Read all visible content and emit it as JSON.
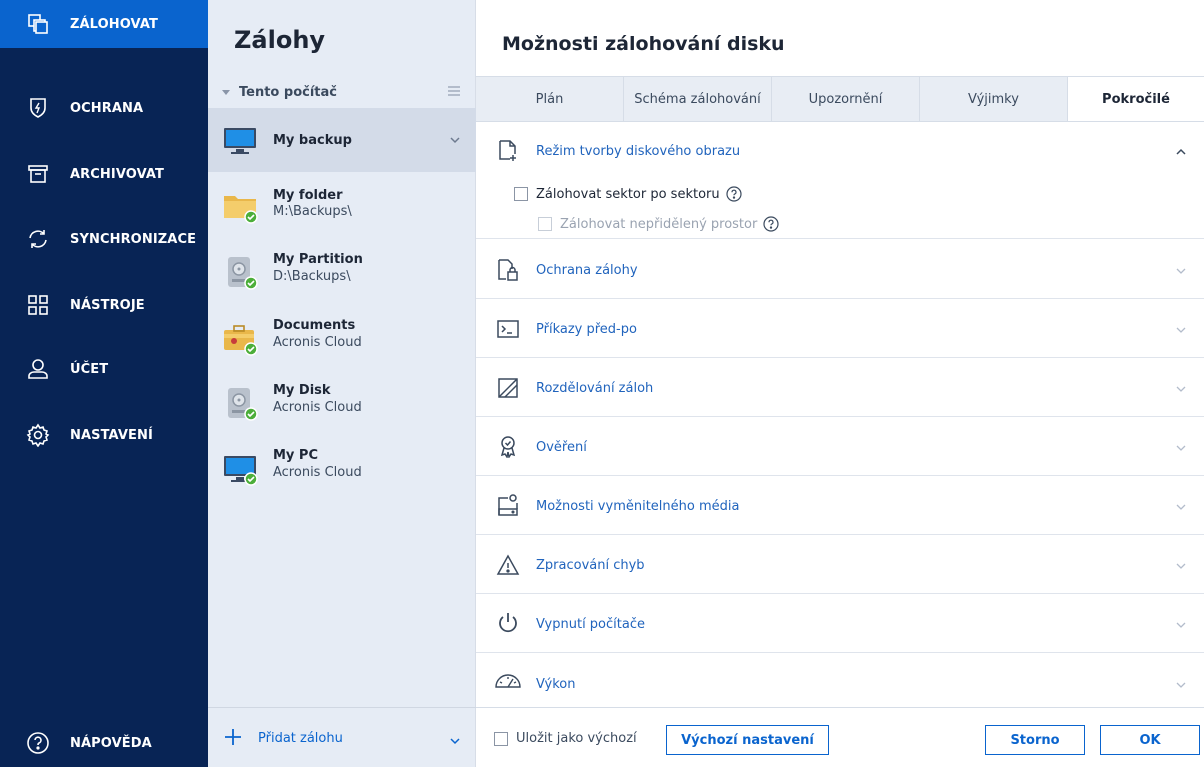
{
  "nav": {
    "items": [
      {
        "label": "ZÁLOHOVAT",
        "icon": "backup-icon"
      },
      {
        "label": "OCHRANA",
        "icon": "shield-icon"
      },
      {
        "label": "ARCHIVOVAT",
        "icon": "archive-icon"
      },
      {
        "label": "SYNCHRONIZACE",
        "icon": "sync-icon"
      },
      {
        "label": "NÁSTROJE",
        "icon": "tools-icon"
      },
      {
        "label": "ÚČET",
        "icon": "account-icon"
      },
      {
        "label": "NASTAVENÍ",
        "icon": "gear-icon"
      }
    ],
    "help": {
      "label": "NÁPOVĚDA",
      "icon": "help-icon"
    },
    "active_color": "#0a64ce",
    "background": "#082455"
  },
  "list": {
    "title": "Zálohy",
    "group": "Tento počítač",
    "items": [
      {
        "name": "My backup",
        "location": "",
        "icon": "monitor-icon"
      },
      {
        "name": "My folder",
        "location": "M:\\Backups\\",
        "icon": "folder-icon"
      },
      {
        "name": "My Partition",
        "location": "D:\\Backups\\",
        "icon": "partition-icon"
      },
      {
        "name": "Documents",
        "location": "Acronis Cloud",
        "icon": "documents-icon"
      },
      {
        "name": "My Disk",
        "location": "Acronis Cloud",
        "icon": "disk-icon"
      },
      {
        "name": "My PC",
        "location": "Acronis Cloud",
        "icon": "monitor-icon"
      }
    ],
    "add_label": "Přidat zálohu"
  },
  "main": {
    "title": "Možnosti zálohování disku",
    "tabs": [
      "Plán",
      "Schéma zálohování",
      "Upozornění",
      "Výjimky",
      "Pokročilé"
    ],
    "active_tab": "Pokročilé",
    "sections": [
      {
        "label": "Režim tvorby diskového obrazu",
        "icon": "disk-image-icon",
        "expanded": true
      },
      {
        "label": "Ochrana zálohy",
        "icon": "lock-icon"
      },
      {
        "label": "Příkazy před-po",
        "icon": "terminal-icon"
      },
      {
        "label": "Rozdělování záloh",
        "icon": "split-icon"
      },
      {
        "label": "Ověření",
        "icon": "validation-icon"
      },
      {
        "label": "Možnosti vyměnitelného média",
        "icon": "removable-media-icon"
      },
      {
        "label": "Zpracování chyb",
        "icon": "warning-icon"
      },
      {
        "label": "Vypnutí počítače",
        "icon": "power-icon"
      },
      {
        "label": "Výkon",
        "icon": "performance-icon"
      }
    ],
    "options": {
      "sector_by_sector": "Zálohovat sektor po sektoru",
      "unallocated": "Zálohovat nepřidělený prostor"
    },
    "footer": {
      "save_default": "Uložit jako výchozí",
      "defaults_button": "Výchozí nastavení",
      "cancel_button": "Storno",
      "ok_button": "OK"
    }
  }
}
